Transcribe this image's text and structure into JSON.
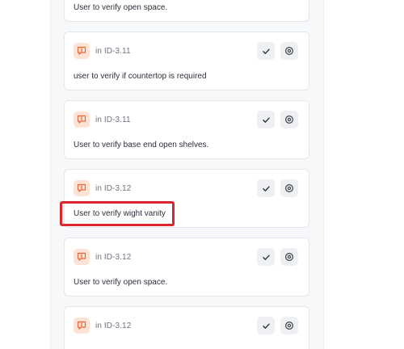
{
  "colors": {
    "accent": "#e8673a",
    "badge_bg": "#fde3d6",
    "highlight": "#d8262c"
  },
  "cards": [
    {
      "location": "",
      "message": "User to verify open space."
    },
    {
      "location": "in ID-3.11",
      "message": "user to verify if countertop is required"
    },
    {
      "location": "in ID-3.11",
      "message": "User to verify base end open shelves."
    },
    {
      "location": "in ID-3.12",
      "message": "User to verify wight vanity"
    },
    {
      "location": "in ID-3.12",
      "message": "User to verify open space."
    },
    {
      "location": "in ID-3.12",
      "message": ""
    }
  ],
  "icons": {
    "badge": "comment-alert-icon",
    "check": "check-icon",
    "target": "target-icon"
  }
}
